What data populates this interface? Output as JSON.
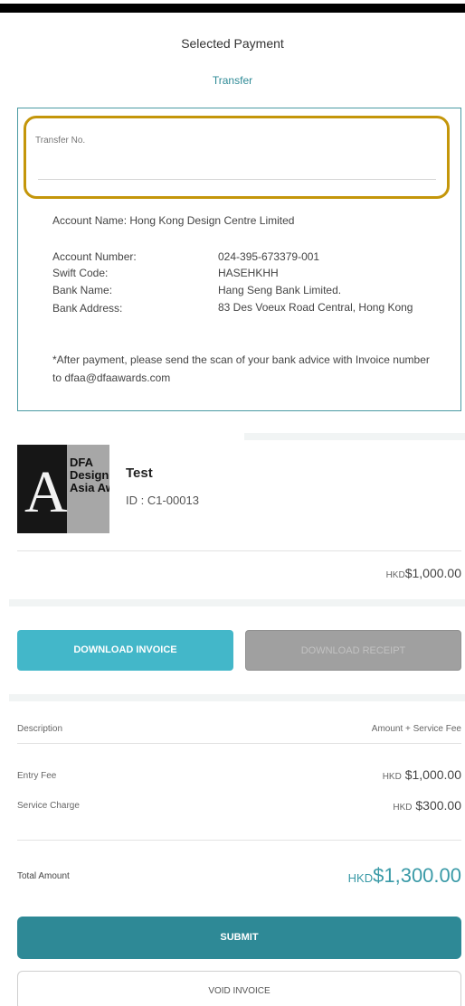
{
  "header": {
    "title": "Selected Payment",
    "method": "Transfer"
  },
  "transfer": {
    "field_label": "Transfer No.",
    "field_value": "",
    "account_name": "Account Name: Hong Kong Design Centre Limited",
    "details": [
      {
        "label": "Account Number:",
        "value": "024-395-673379-001"
      },
      {
        "label": "Swift Code:",
        "value": "HASEHKHH"
      },
      {
        "label": "Bank Name:",
        "value": "Hang Seng Bank Limited."
      },
      {
        "label": "Bank Address:",
        "value": "83 Des Voeux Road Central, Hong Kong"
      }
    ],
    "note": "*After payment, please send the scan of your bank advice with Invoice number to dfaa@dfaawards.com"
  },
  "entry": {
    "thumb_letter": "A",
    "thumb_line1": "DFA",
    "thumb_line2": "Design",
    "thumb_line3": "Asia Aw",
    "title": "Test",
    "id": "ID : C1-00013",
    "price_currency": "HKD",
    "price_value": "$1,000.00"
  },
  "actions": {
    "download_invoice": "DOWNLOAD INVOICE",
    "download_receipt": "DOWNLOAD RECEIPT",
    "submit": "SUBMIT",
    "void": "VOID INVOICE"
  },
  "summary": {
    "col_description": "Description",
    "col_amount": "Amount + Service Fee",
    "rows": [
      {
        "label": "Entry Fee",
        "currency": "HKD",
        "amount": "$1,000.00"
      },
      {
        "label": "Service Charge",
        "currency": "HKD",
        "amount": "$300.00"
      }
    ],
    "total_label": "Total Amount",
    "total_currency": "HKD",
    "total_amount": "$1,300.00"
  },
  "colors": {
    "accent": "#43b7c9",
    "submit": "#2e8996",
    "highlight": "#c4960a"
  }
}
